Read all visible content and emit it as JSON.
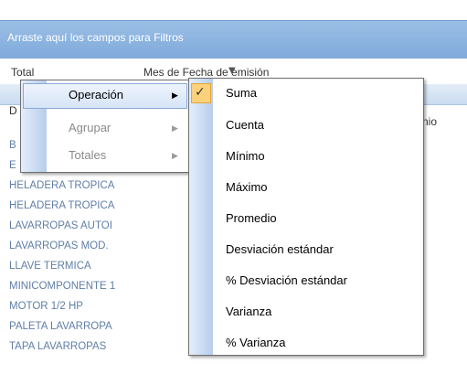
{
  "filter_bar": {
    "text": "Arraste aquí los campos para Filtros"
  },
  "pivot": {
    "total_label": "Total",
    "column_field": "Mes de Fecha de emisión",
    "column_field_arrow": "▼",
    "col_header_left": "D",
    "col_header_right": "nio"
  },
  "rows": [
    "B",
    "E",
    "HELADERA TROPICA",
    "HELADERA TROPICA",
    "LAVARROPAS AUTOI",
    "LAVARROPAS MOD.",
    "LLAVE TERMICA",
    "MINICOMPONENTE 1",
    "MOTOR 1/2 HP",
    "PALETA LAVARROPA",
    "TAPA LAVARROPAS"
  ],
  "context_menu": {
    "items": [
      {
        "label": "Operación",
        "enabled": true,
        "arrow": "▶"
      },
      {
        "label": "Agrupar",
        "enabled": false,
        "arrow": "▶"
      },
      {
        "label": "Totales",
        "enabled": false,
        "arrow": "▶"
      }
    ]
  },
  "submenu": {
    "check_glyph": "✓",
    "items": [
      {
        "label": "Suma",
        "checked": true
      },
      {
        "label": "Cuenta"
      },
      {
        "label": "Mínimo"
      },
      {
        "label": "Máximo"
      },
      {
        "label": "Promedio"
      },
      {
        "label": "Desviación estándar"
      },
      {
        "label": "% Desviación estándar"
      },
      {
        "label": "Varianza"
      },
      {
        "label": "% Varianza"
      }
    ]
  },
  "colors": {
    "filter_bar": "#7fa9da",
    "row_text": "#5f7ea6",
    "check_highlight": "#fbd27a",
    "disabled_text": "#8a8a8a"
  }
}
